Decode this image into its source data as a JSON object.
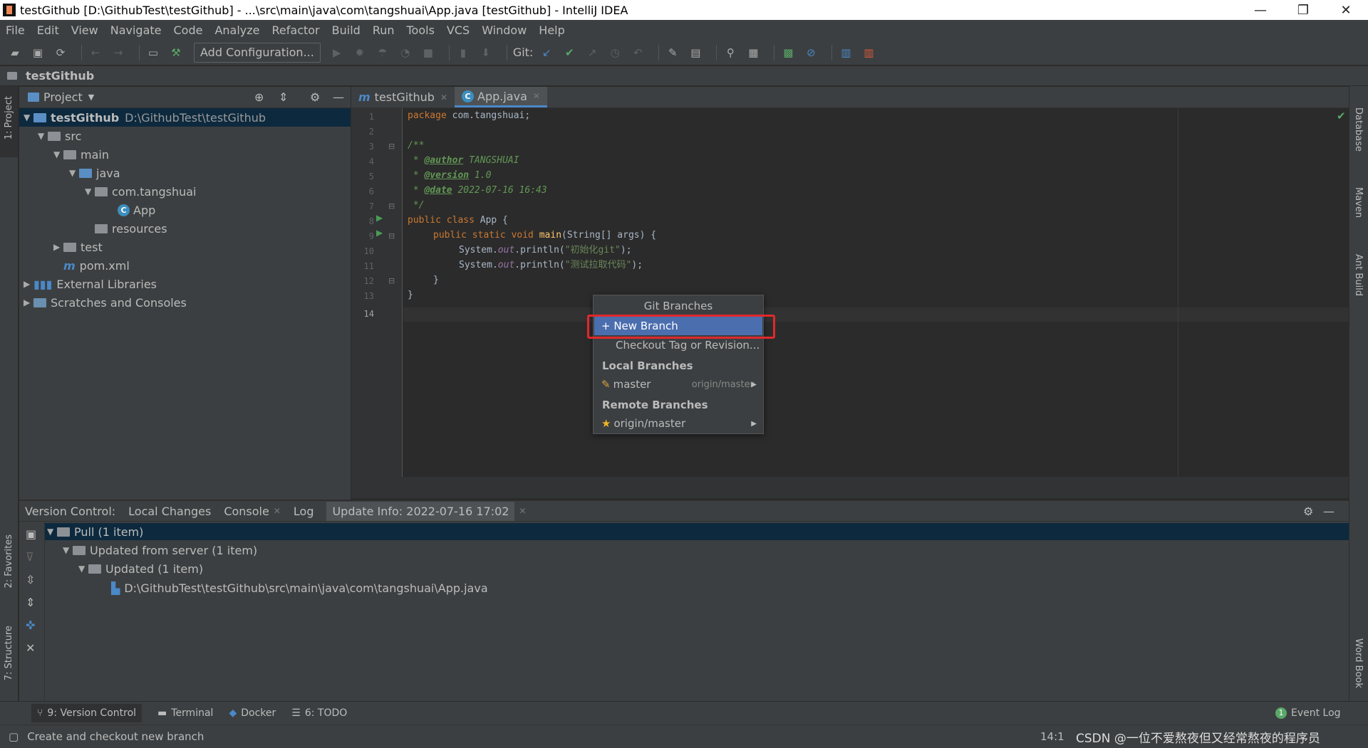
{
  "window": {
    "title": "testGithub [D:\\GithubTest\\testGithub] - ...\\src\\main\\java\\com\\tangshuai\\App.java [testGithub] - IntelliJ IDEA",
    "minimize": "—",
    "restore": "❐",
    "close": "✕"
  },
  "menu": [
    "File",
    "Edit",
    "View",
    "Navigate",
    "Code",
    "Analyze",
    "Refactor",
    "Build",
    "Run",
    "Tools",
    "VCS",
    "Window",
    "Help"
  ],
  "toolbar": {
    "add_configuration": "Add Configuration...",
    "git_label": "Git:"
  },
  "navbar": {
    "project": "testGithub"
  },
  "left_stripe": {
    "project": "1: Project",
    "favorites": "2: Favorites",
    "structure": "7: Structure"
  },
  "right_stripe": {
    "database": "Database",
    "maven": "Maven",
    "ant": "Ant Build",
    "wordbook": "Word Book"
  },
  "project_panel": {
    "title": "Project",
    "tree": [
      {
        "label": "testGithub",
        "path": "D:\\GithubTest\\testGithub"
      },
      {
        "label": "src"
      },
      {
        "label": "main"
      },
      {
        "label": "java"
      },
      {
        "label": "com.tangshuai"
      },
      {
        "label": "App"
      },
      {
        "label": "resources"
      },
      {
        "label": "test"
      },
      {
        "label": "pom.xml"
      },
      {
        "label": "External Libraries"
      },
      {
        "label": "Scratches and Consoles"
      }
    ]
  },
  "editor": {
    "tabs": [
      {
        "label": "testGithub",
        "icon": "m"
      },
      {
        "label": "App.java",
        "icon": "C"
      }
    ],
    "line_numbers": [
      "1",
      "2",
      "3",
      "4",
      "5",
      "6",
      "7",
      "8",
      "9",
      "10",
      "11",
      "12",
      "13",
      "14"
    ],
    "code": {
      "l1_kw": "package",
      "l1_rest": " com.tangshuai;",
      "l3": "/**",
      "l4_star": " * ",
      "l4_tag": "@author",
      "l4_val": " TANGSHUAI",
      "l5_tag": "@version",
      "l5_val": " 1.0",
      "l6_tag": "@date",
      "l6_val": " 2022-07-16 16:43",
      "l7": " */",
      "l8_kw": "public class",
      "l8_rest": " App {",
      "l9_kw": "public static void",
      "l9_fn": "main",
      "l9_rest": "(String[] args) {",
      "l10_a": "System.",
      "l10_out": "out",
      "l10_b": ".println(",
      "l10_str": "\"初始化git\"",
      "l10_c": ");",
      "l11_str": "\"测试拉取代码\"",
      "l12": "}",
      "l13": "}"
    }
  },
  "git_popup": {
    "title": "Git Branches",
    "new_branch": "+ New Branch",
    "checkout": "Checkout Tag or Revision...",
    "local_header": "Local Branches",
    "local": {
      "name": "master",
      "tracking": "origin/master"
    },
    "remote_header": "Remote Branches",
    "remote": {
      "name": "origin/master"
    }
  },
  "version_control": {
    "tabs": [
      "Version Control:",
      "Local Changes",
      "Console",
      "Log",
      "Update Info: 2022-07-16 17:02"
    ],
    "tree": [
      "Pull (1 item)",
      "Updated from server (1 item)",
      "Updated (1 item)",
      "D:\\GithubTest\\testGithub\\src\\main\\java\\com\\tangshuai\\App.java"
    ]
  },
  "bottom_tools": [
    "9: Version Control",
    "Terminal",
    "Docker",
    "6: TODO"
  ],
  "event_log": {
    "badge": "1",
    "label": "Event Log"
  },
  "status": {
    "message": "Create and checkout new branch",
    "position": "14:1",
    "watermark": "CSDN @一位不爱熬夜但又经常熬夜的程序员"
  },
  "colors": {
    "accent": "#4b6eaf",
    "highlight_box": "#e0282c",
    "bg": "#2b2b2b",
    "panel": "#3c3f41"
  }
}
